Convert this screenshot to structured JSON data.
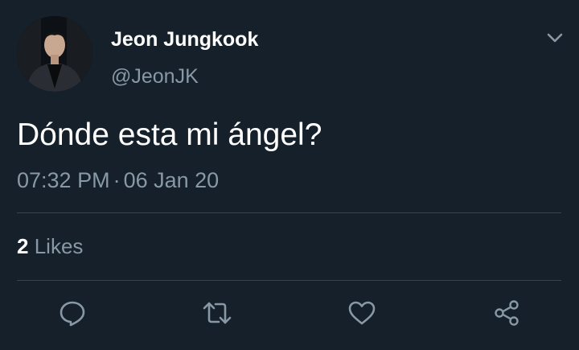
{
  "tweet": {
    "author": {
      "display_name": "Jeon Jungkook",
      "handle": "@JeonJK"
    },
    "text": "Dónde esta mi ángel?",
    "time": "07:32 PM",
    "separator": "·",
    "date": "06 Jan 20",
    "likes": {
      "count": "2",
      "label": "Likes"
    }
  },
  "actions": {
    "reply_icon": "comment-icon",
    "retweet_icon": "retweet-icon",
    "like_icon": "heart-icon",
    "share_icon": "share-icon"
  },
  "colors": {
    "background": "#15202b",
    "text": "#ffffff",
    "secondary_text": "#8899a6",
    "divider": "#38444d"
  }
}
